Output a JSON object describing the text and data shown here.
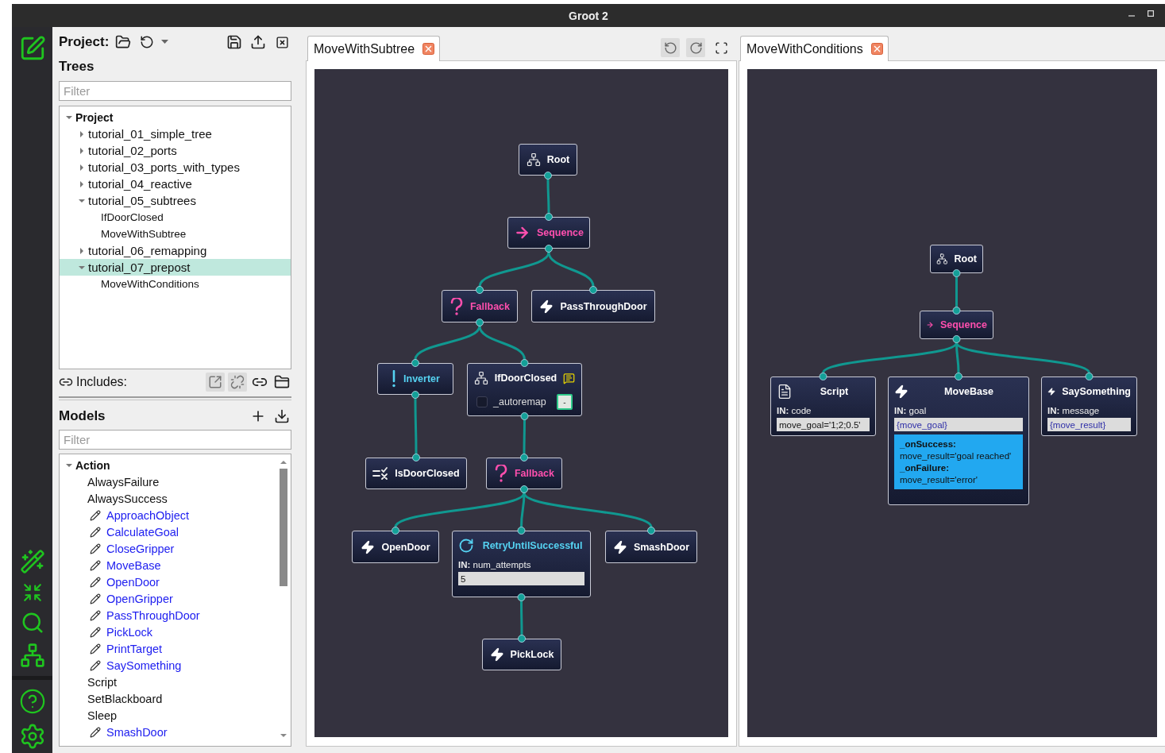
{
  "window": {
    "title": "Groot 2"
  },
  "project_bar": {
    "label": "Project:"
  },
  "trees": {
    "title": "Trees",
    "filter": {
      "placeholder": "Filter"
    },
    "items": [
      {
        "label": "Project",
        "kind": "folder",
        "expanded": true,
        "selected": false,
        "children": [
          {
            "label": "tutorial_01_simple_tree",
            "kind": "file",
            "expanded": false,
            "selected": false
          },
          {
            "label": "tutorial_02_ports",
            "kind": "file",
            "expanded": false,
            "selected": false
          },
          {
            "label": "tutorial_03_ports_with_types",
            "kind": "file",
            "expanded": false,
            "selected": false
          },
          {
            "label": "tutorial_04_reactive",
            "kind": "file",
            "expanded": false,
            "selected": false
          },
          {
            "label": "tutorial_05_subtrees",
            "kind": "file",
            "expanded": true,
            "selected": false,
            "children": [
              {
                "label": "IfDoorClosed",
                "kind": "tree",
                "selected": false
              },
              {
                "label": "MoveWithSubtree",
                "kind": "tree",
                "selected": false
              }
            ]
          },
          {
            "label": "tutorial_06_remapping",
            "kind": "file",
            "expanded": false,
            "selected": false
          },
          {
            "label": "tutorial_07_prepost",
            "kind": "file",
            "expanded": true,
            "selected": true,
            "children": [
              {
                "label": "MoveWithConditions",
                "kind": "tree",
                "selected": false
              }
            ]
          }
        ]
      }
    ]
  },
  "includes": {
    "label": "Includes:"
  },
  "models": {
    "title": "Models",
    "filter": {
      "placeholder": "Filter"
    },
    "items": [
      {
        "label": "Action",
        "expanded": true,
        "children": [
          {
            "label": "AlwaysFailure",
            "editable": false
          },
          {
            "label": "AlwaysSuccess",
            "editable": false
          },
          {
            "label": "ApproachObject",
            "editable": true
          },
          {
            "label": "CalculateGoal",
            "editable": true
          },
          {
            "label": "CloseGripper",
            "editable": true
          },
          {
            "label": "MoveBase",
            "editable": true
          },
          {
            "label": "OpenDoor",
            "editable": true
          },
          {
            "label": "OpenGripper",
            "editable": true
          },
          {
            "label": "PassThroughDoor",
            "editable": true
          },
          {
            "label": "PickLock",
            "editable": true
          },
          {
            "label": "PrintTarget",
            "editable": true
          },
          {
            "label": "SaySomething",
            "editable": true
          },
          {
            "label": "Script",
            "editable": false
          },
          {
            "label": "SetBlackboard",
            "editable": false
          },
          {
            "label": "Sleep",
            "editable": false
          },
          {
            "label": "SmashDoor",
            "editable": true
          }
        ]
      }
    ]
  },
  "editors": [
    {
      "tab": {
        "label": "MoveWithSubtree"
      },
      "root": {
        "kind": "root",
        "label": "Root",
        "children": [
          {
            "kind": "sequence",
            "label": "Sequence",
            "children": [
              {
                "kind": "fallback",
                "label": "Fallback",
                "children": [
                  {
                    "kind": "inverter",
                    "label": "Inverter",
                    "children": [
                      {
                        "kind": "condition",
                        "label": "IsDoorClosed"
                      }
                    ]
                  },
                  {
                    "kind": "subtree",
                    "label": "IfDoorClosed",
                    "comment": true,
                    "remap": {
                      "label": "_autoremap",
                      "checked": false,
                      "button": "-"
                    },
                    "children": [
                      {
                        "kind": "fallback",
                        "label": "Fallback",
                        "children": [
                          {
                            "kind": "action",
                            "label": "OpenDoor"
                          },
                          {
                            "kind": "decorator",
                            "label": "RetryUntilSuccessful",
                            "ports": [
                              {
                                "direction": "IN:",
                                "name": "num_attempts",
                                "value": "5",
                                "reference": false
                              }
                            ],
                            "children": [
                              {
                                "kind": "action",
                                "label": "PickLock"
                              }
                            ]
                          },
                          {
                            "kind": "action",
                            "label": "SmashDoor"
                          }
                        ]
                      }
                    ]
                  }
                ]
              },
              {
                "kind": "action",
                "label": "PassThroughDoor"
              }
            ]
          }
        ]
      }
    },
    {
      "tab": {
        "label": "MoveWithConditions"
      },
      "root": {
        "kind": "root",
        "label": "Root",
        "children": [
          {
            "kind": "sequence",
            "label": "Sequence",
            "children": [
              {
                "kind": "script",
                "label": "Script",
                "ports": [
                  {
                    "direction": "IN:",
                    "name": "code",
                    "value": "move_goal='1;2;0.5'",
                    "reference": false
                  }
                ]
              },
              {
                "kind": "action",
                "label": "MoveBase",
                "ports": [
                  {
                    "direction": "IN:",
                    "name": "goal",
                    "value": "{move_goal}",
                    "reference": true
                  }
                ],
                "conditions": [
                  {
                    "label": "_onSuccess:",
                    "value": "move_result='goal reached'"
                  },
                  {
                    "label": "_onFailure:",
                    "value": "move_result='error'"
                  }
                ]
              },
              {
                "kind": "action",
                "label": "SaySomething",
                "ports": [
                  {
                    "direction": "IN:",
                    "name": "message",
                    "value": "{move_result}",
                    "reference": true
                  }
                ]
              }
            ]
          }
        ]
      }
    }
  ]
}
